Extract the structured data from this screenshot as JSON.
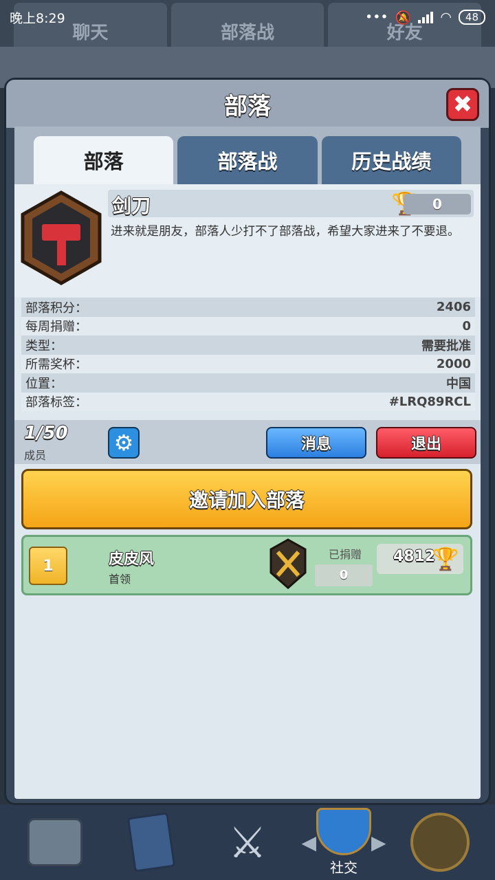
{
  "status_bar": {
    "time": "晚上8:29",
    "battery": "48"
  },
  "background": {
    "tabs": [
      "聊天",
      "部落战",
      "好友"
    ],
    "nav": {
      "social_label": "社交"
    }
  },
  "modal": {
    "title": "部落",
    "close_label": "✖",
    "tabs": [
      {
        "label": "部落",
        "active": true
      },
      {
        "label": "部落战",
        "active": false
      },
      {
        "label": "历史战绩",
        "active": false
      }
    ],
    "clan": {
      "name": "剑刀",
      "trophies": "0",
      "description": "进来就是朋友，部落人少打不了部落战，希望大家进来了不要退。",
      "info": [
        {
          "label": "部落积分：",
          "value": "2406"
        },
        {
          "label": "每周捐赠：",
          "value": "0"
        },
        {
          "label": "类型：",
          "value": "需要批准"
        },
        {
          "label": "所需奖杯：",
          "value": "2000"
        },
        {
          "label": "位置：",
          "value": "中国"
        },
        {
          "label": "部落标签：",
          "value": "#LRQ89RCL"
        }
      ]
    },
    "members_count": "1/50",
    "members_label": "成员",
    "message_button": "消息",
    "leave_button": "退出",
    "invite_button": "邀请加入部落",
    "members": [
      {
        "rank": "1",
        "name": "皮皮风",
        "role": "首领",
        "donated_label": "已捐赠",
        "donated": "0",
        "trophies": "4812"
      }
    ]
  },
  "colors": {
    "accent_blue": "#2c7fe0",
    "accent_red": "#d6212d",
    "accent_gold": "#f5a416",
    "member_row": "#aad7b4"
  }
}
